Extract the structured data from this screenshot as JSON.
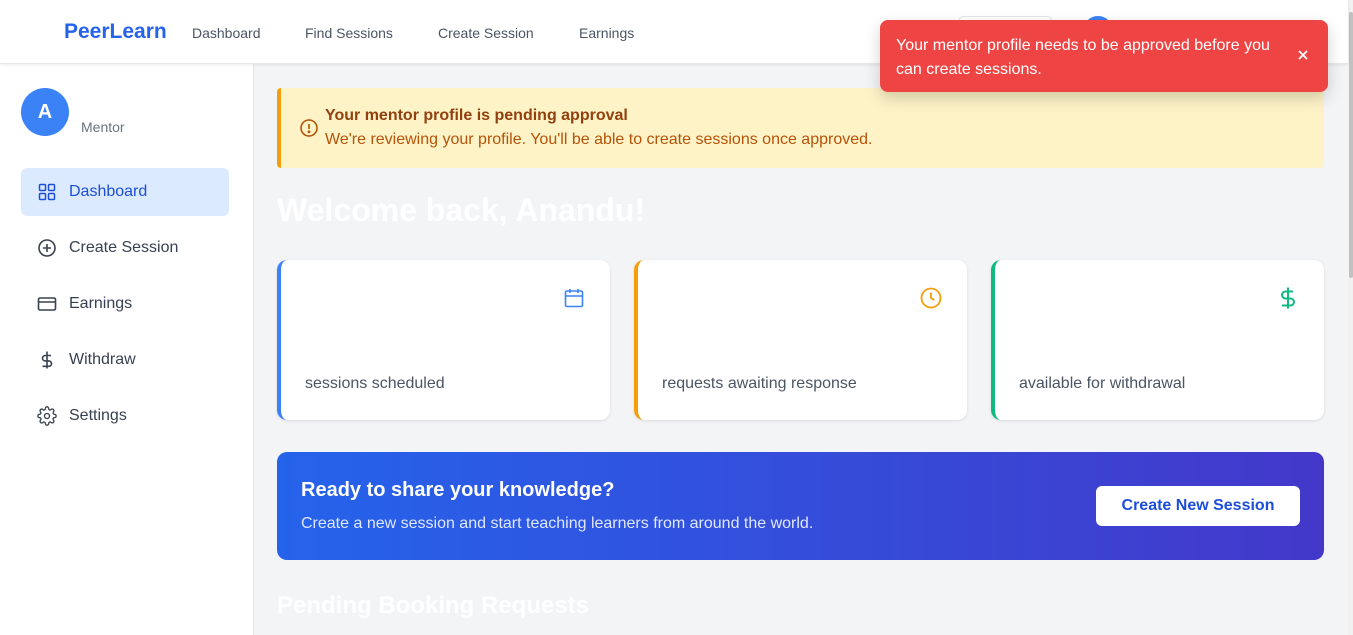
{
  "nav": {
    "brand": "PeerLearn",
    "links": [
      "Dashboard",
      "Find Sessions",
      "Create Session",
      "Earnings"
    ]
  },
  "sidebar": {
    "avatar_letter": "A",
    "role": "Mentor",
    "items": [
      {
        "label": "Dashboard",
        "icon": "grid-icon",
        "active": true
      },
      {
        "label": "Create Session",
        "icon": "plus-circle-icon"
      },
      {
        "label": "Earnings",
        "icon": "credit-card-icon"
      },
      {
        "label": "Withdraw",
        "icon": "dollar-icon"
      },
      {
        "label": "Settings",
        "icon": "gear-icon"
      }
    ]
  },
  "alert": {
    "title": "Your mentor profile is pending approval",
    "body": "We're reviewing your profile. You'll be able to create sessions once approved."
  },
  "welcome": "Welcome back, Anandu!",
  "cards": [
    {
      "label": "sessions scheduled",
      "icon": "calendar-icon",
      "color": "#3b82f6"
    },
    {
      "label": "requests awaiting response",
      "icon": "clock-icon",
      "color": "#f59e0b"
    },
    {
      "label": "available for withdrawal",
      "icon": "dollar-icon",
      "color": "#10b981"
    }
  ],
  "cta": {
    "title": "Ready to share your knowledge?",
    "subtitle": "Create a new session and start teaching learners from around the world.",
    "button": "Create New Session"
  },
  "pending_heading": "Pending Booking Requests",
  "toast": {
    "message": "Your mentor profile needs to be approved before you can create sessions.",
    "color": "#ef4444"
  }
}
